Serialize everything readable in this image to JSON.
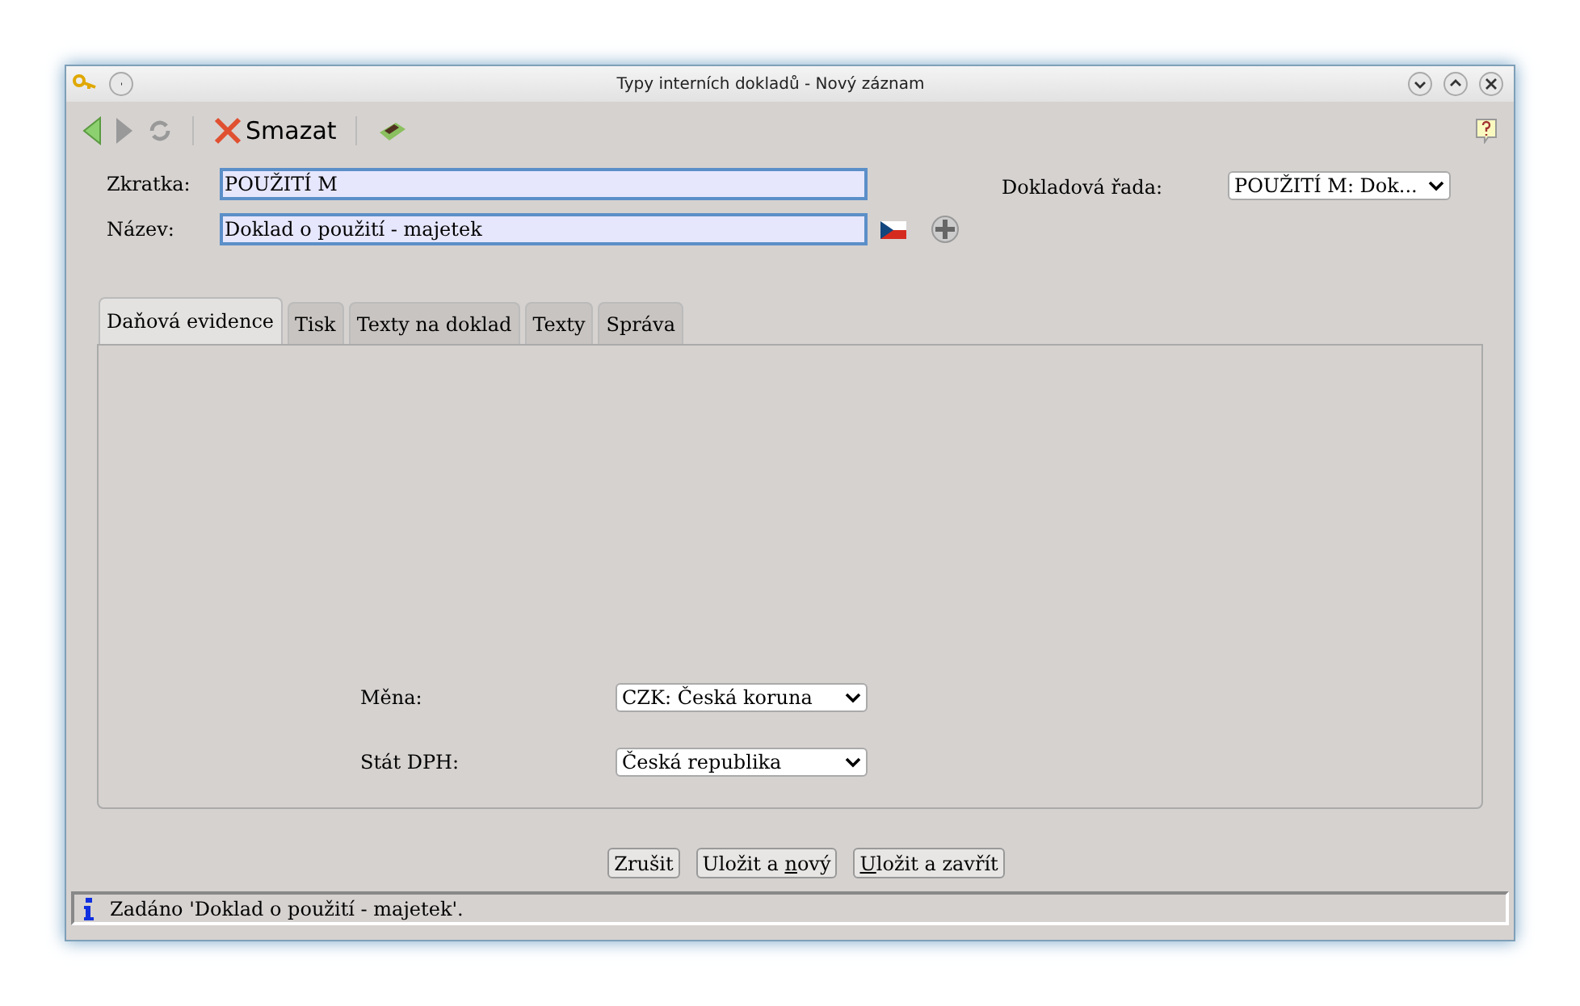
{
  "window": {
    "title": "Typy interních dokladů - Nový záznam"
  },
  "toolbar": {
    "delete_label": "Smazat"
  },
  "form": {
    "zkratka": {
      "label": "Zkratka:",
      "value": "POUŽITÍ M"
    },
    "nazev": {
      "label": "Název:",
      "value": "Doklad o použití - majetek"
    },
    "rada": {
      "label": "Dokladová řada:",
      "value": "POUŽITÍ M: Dok..."
    }
  },
  "tabs": [
    {
      "label": "Daňová evidence",
      "selected": true
    },
    {
      "label": "Tisk",
      "selected": false
    },
    {
      "label": "Texty na doklad",
      "selected": false
    },
    {
      "label": "Texty",
      "selected": false
    },
    {
      "label": "Správa",
      "selected": false
    }
  ],
  "panel_fields": [
    {
      "label": "Měna:",
      "value": "CZK: Česká koruna"
    },
    {
      "label": "Stát DPH:",
      "value": "Česká republika"
    }
  ],
  "buttons": [
    {
      "before": "Zrušit"
    },
    {
      "before": "Uložit a ",
      "key": "n",
      "after": "ový"
    },
    {
      "key": "U",
      "after": "ložit a zavřít"
    }
  ],
  "status_bar": {
    "text": "Zadáno 'Doklad o použití - majetek'."
  }
}
